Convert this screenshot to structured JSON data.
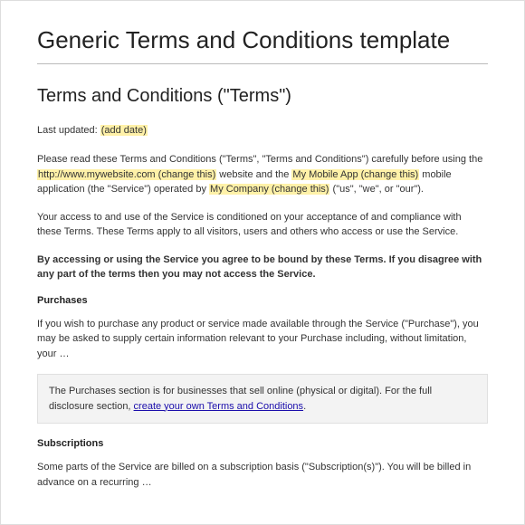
{
  "title": "Generic Terms and Conditions template",
  "subtitle": "Terms and Conditions (\"Terms\")",
  "meta": {
    "label": "Last updated: ",
    "placeholder": "(add date)"
  },
  "intro": {
    "p1a": "Please read these Terms and Conditions (\"Terms\", \"Terms and Conditions\") carefully before using the ",
    "hl1": "http://www.mywebsite.com (change this)",
    "p1b": " website and the ",
    "hl2": "My Mobile App (change this)",
    "p1c": " mobile application (the \"Service\") operated by ",
    "hl3": "My Company (change this)",
    "p1d": " (\"us\", \"we\", or \"our\")."
  },
  "p2": "Your access to and use of the Service is conditioned on your acceptance of and compliance with these Terms. These Terms apply to all visitors, users and others who access or use the Service.",
  "p3": "By accessing or using the Service you agree to be bound by these Terms. If you disagree with any part of the terms then you may not access the Service.",
  "purchases": {
    "heading": "Purchases",
    "body": "If you wish to purchase any product or service made available through the Service (\"Purchase\"), you may be asked to supply certain information relevant to your Purchase including, without limitation, your …",
    "note_a": "The Purchases section is for businesses that sell online (physical or digital). For the full disclosure section, ",
    "note_link": "create your own Terms and Conditions",
    "note_b": "."
  },
  "subscriptions": {
    "heading": "Subscriptions",
    "body": "Some parts of the Service are billed on a subscription basis (\"Subscription(s)\"). You will be billed in advance on a recurring …"
  }
}
